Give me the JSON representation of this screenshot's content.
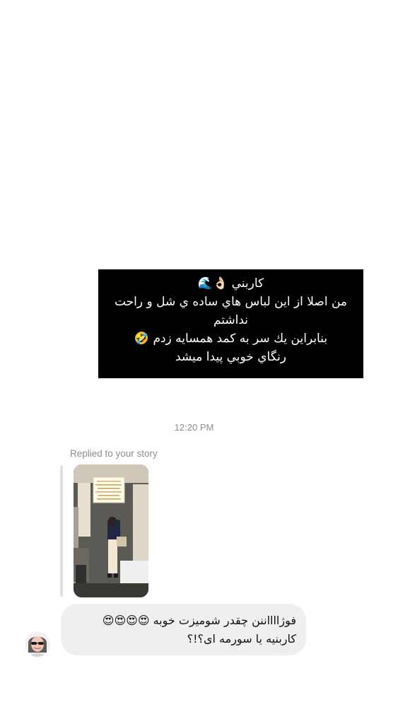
{
  "story": {
    "lines": [
      "كاربني 👌🏻🌊",
      "من اصلا از اين لباس هاي ساده ي شل و راحت",
      "نداشتم",
      "بنابراين يك سر به كمد همسايه زدم 🤣",
      "رنگاي خوبي پيدا ميشد"
    ]
  },
  "thread": {
    "timestamp": "12:20 PM",
    "replied_label": "Replied to your story",
    "message_lines": [
      "فوژااااننن چقدر شومیزت خوبه 😍😍😍😍",
      "کاربنیه یا سورمه ای؟!؟"
    ]
  },
  "colors": {
    "background": "#ffffff",
    "story_box": "#000000",
    "bubble": "#efefef",
    "meta_text": "#8e8e8e",
    "reply_bar": "#e0e0e0"
  },
  "icons": {
    "story_thumbnail": "story-image",
    "avatar": "user-avatar"
  }
}
